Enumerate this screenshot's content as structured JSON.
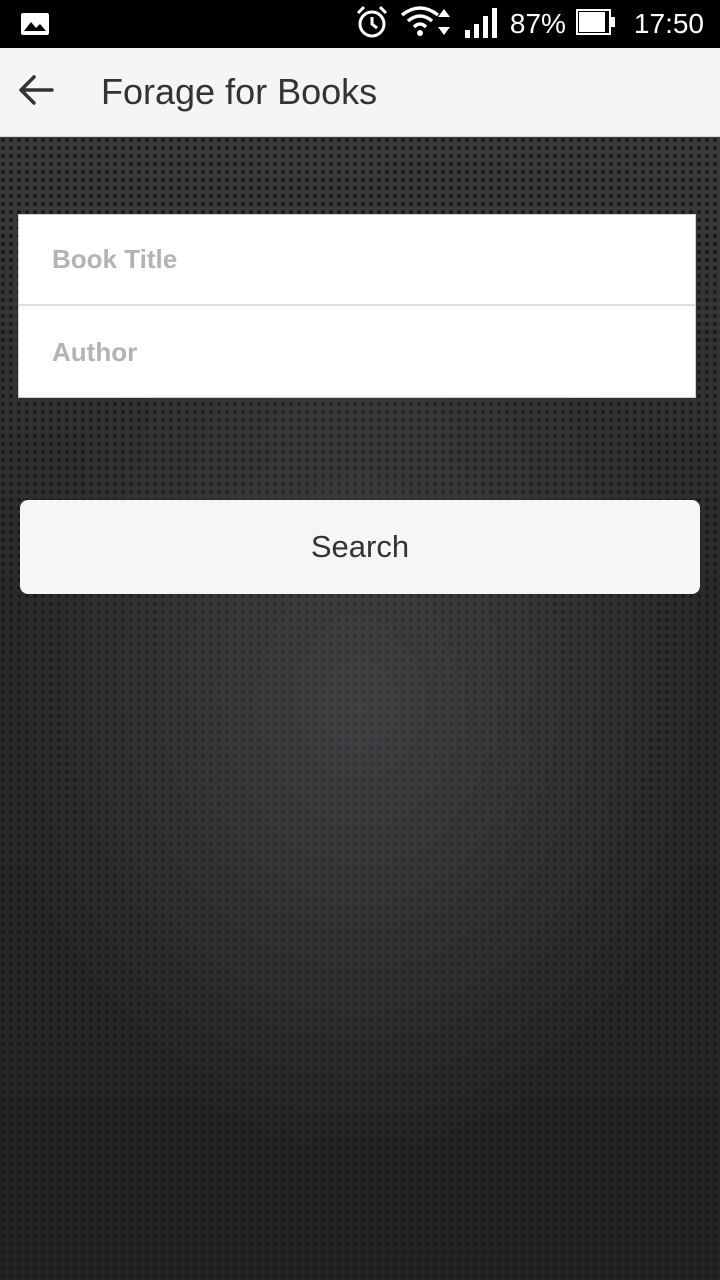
{
  "status_bar": {
    "battery_percent": "87%",
    "time": "17:50",
    "icons": [
      "image-icon",
      "alarm-icon",
      "wifi-icon",
      "signal-icon",
      "battery-icon"
    ]
  },
  "app_bar": {
    "title": "Forage for Books",
    "back_icon": "arrow-left-icon"
  },
  "form": {
    "book_title": {
      "placeholder": "Book Title",
      "value": ""
    },
    "author": {
      "placeholder": "Author",
      "value": ""
    }
  },
  "search_button": {
    "label": "Search"
  },
  "colors": {
    "app_bar_bg": "#f5f5f5",
    "status_bar_bg": "#000000",
    "text_dark": "#333333",
    "placeholder": "#b3b3b3"
  }
}
